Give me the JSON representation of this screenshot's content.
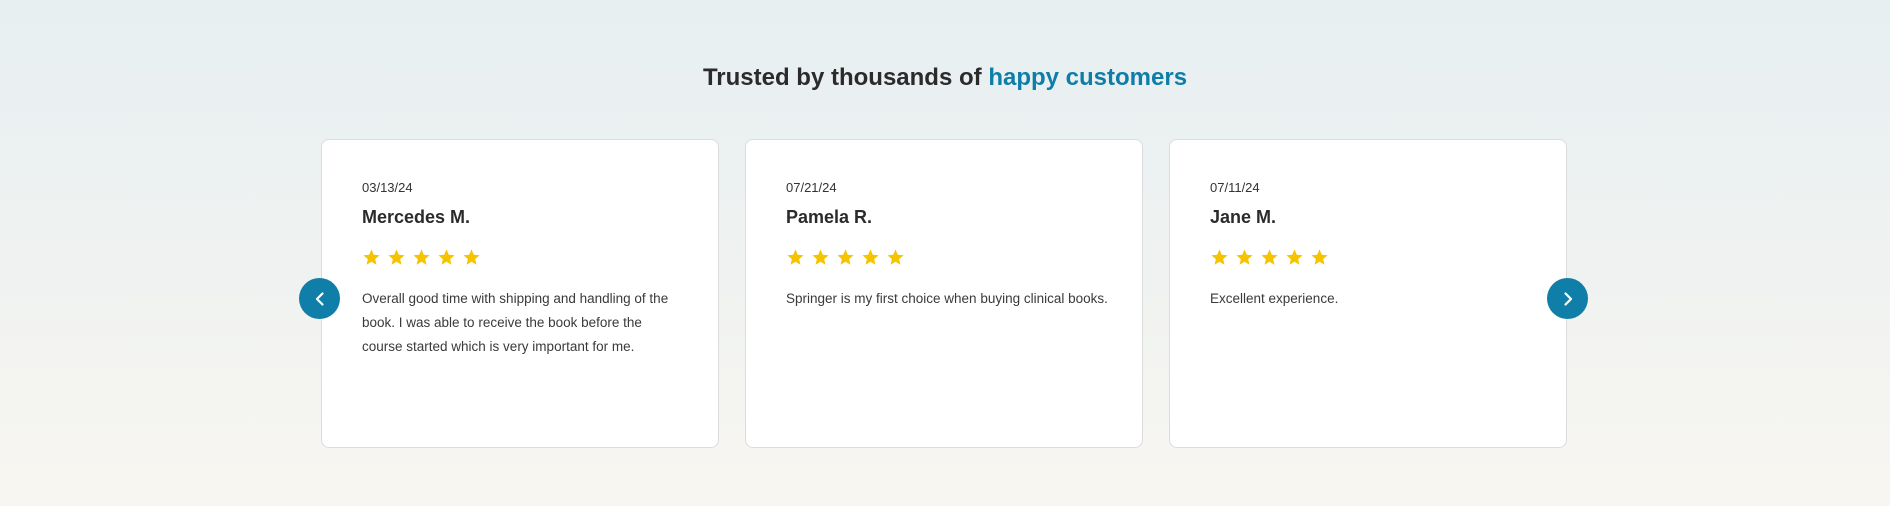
{
  "heading": {
    "prefix": "Trusted by thousands of ",
    "accent": "happy customers"
  },
  "colors": {
    "accent": "#0e7ea8",
    "star": "#f5c400"
  },
  "navigation": {
    "prev_icon": "chevron-left-icon",
    "next_icon": "chevron-right-icon"
  },
  "reviews": [
    {
      "date": "03/13/24",
      "name": "Mercedes M.",
      "rating": 5,
      "text": "Overall good time with shipping and handling of the book. I was able to receive the book before the course started which is very important for me."
    },
    {
      "date": "07/21/24",
      "name": "Pamela R.",
      "rating": 5,
      "text": "Springer is my first choice when buying clinical books."
    },
    {
      "date": "07/11/24",
      "name": "Jane M.",
      "rating": 5,
      "text": "Excellent experience."
    }
  ]
}
